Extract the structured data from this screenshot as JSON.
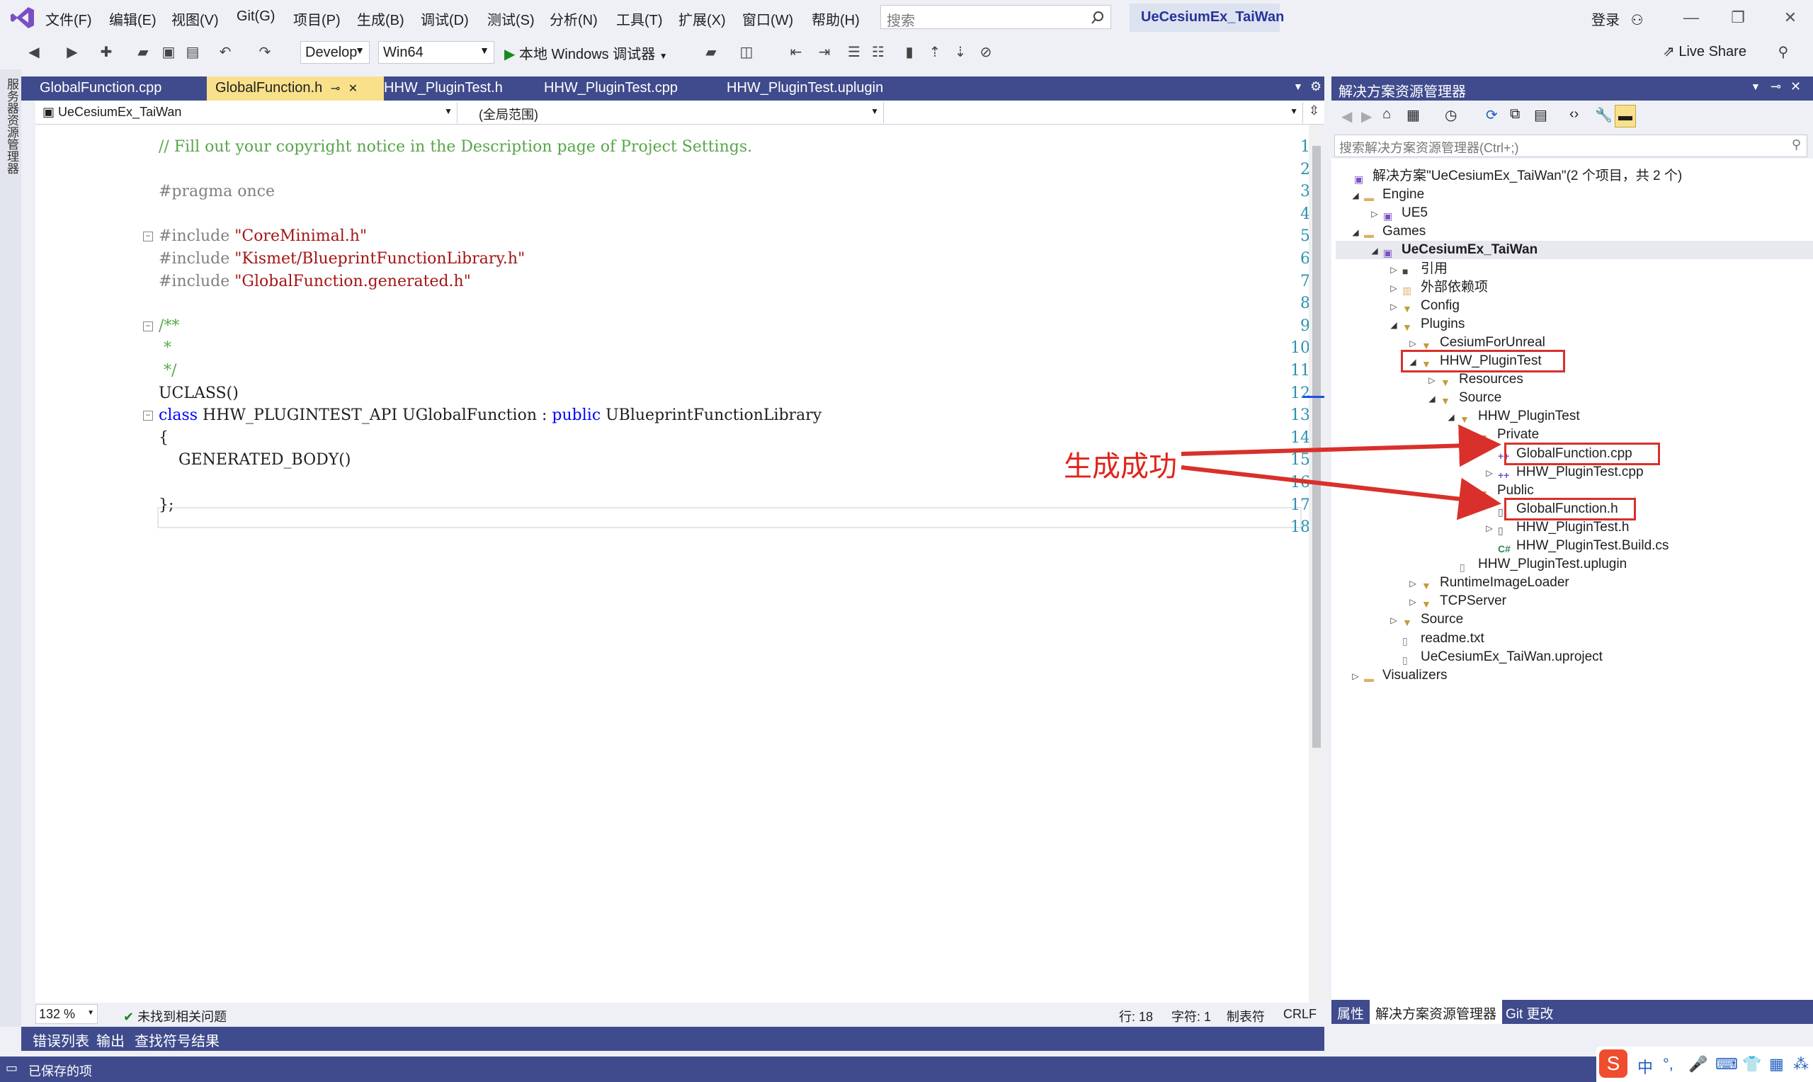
{
  "menubar": {
    "items": [
      "文件(F)",
      "编辑(E)",
      "视图(V)",
      "Git(G)",
      "项目(P)",
      "生成(B)",
      "调试(D)",
      "测试(S)",
      "分析(N)",
      "工具(T)",
      "扩展(X)",
      "窗口(W)",
      "帮助(H)"
    ],
    "search_placeholder": "搜索",
    "solution_title": "UeCesiumEx_TaiWan",
    "login_label": "登录"
  },
  "toolbar": {
    "config": "Develop",
    "platform": "Win64",
    "run_label": "本地 Windows 调试器",
    "live_share": "Live Share"
  },
  "tabs": [
    {
      "label": "GlobalFunction.cpp"
    },
    {
      "label": "GlobalFunction.h",
      "pin": "⊸",
      "close": "✕"
    },
    {
      "label": "HHW_PluginTest.h"
    },
    {
      "label": "HHW_PluginTest.cpp"
    },
    {
      "label": "HHW_PluginTest.uplugin"
    }
  ],
  "navbar": {
    "project": "UeCesiumEx_TaiWan",
    "scope": "(全局范围)",
    "member": ""
  },
  "code_lines": [
    {
      "n": "1",
      "parts": [
        [
          "cm",
          "// Fill out your copyright notice in the Description page of Project Settings."
        ]
      ]
    },
    {
      "n": "2",
      "parts": []
    },
    {
      "n": "3",
      "parts": [
        [
          "pp",
          "#pragma once"
        ]
      ]
    },
    {
      "n": "4",
      "parts": []
    },
    {
      "n": "5",
      "parts": [
        [
          "pp",
          "#include "
        ],
        [
          "str",
          "\"CoreMinimal.h\""
        ]
      ]
    },
    {
      "n": "6",
      "parts": [
        [
          "pp",
          "#include "
        ],
        [
          "str",
          "\"Kismet/BlueprintFunctionLibrary.h\""
        ]
      ]
    },
    {
      "n": "7",
      "parts": [
        [
          "pp",
          "#include "
        ],
        [
          "str",
          "\"GlobalFunction.generated.h\""
        ]
      ]
    },
    {
      "n": "8",
      "parts": []
    },
    {
      "n": "9",
      "parts": [
        [
          "cm",
          "/**"
        ]
      ]
    },
    {
      "n": "10",
      "parts": [
        [
          "cm",
          " *"
        ]
      ]
    },
    {
      "n": "11",
      "parts": [
        [
          "cm",
          " */"
        ]
      ]
    },
    {
      "n": "12",
      "parts": [
        [
          "",
          "UCLASS()"
        ]
      ]
    },
    {
      "n": "13",
      "parts": [
        [
          "kw",
          "class"
        ],
        [
          "",
          " HHW_PLUGINTEST_API UGlobalFunction : "
        ],
        [
          "kw",
          "public"
        ],
        [
          "",
          " UBlueprintFunctionLibrary"
        ]
      ]
    },
    {
      "n": "14",
      "parts": [
        [
          "",
          "{"
        ]
      ]
    },
    {
      "n": "15",
      "parts": [
        [
          "",
          "    GENERATED_BODY()"
        ]
      ]
    },
    {
      "n": "16",
      "parts": []
    },
    {
      "n": "17",
      "parts": [
        [
          "",
          "};"
        ]
      ]
    },
    {
      "n": "18",
      "parts": []
    }
  ],
  "editor_status": {
    "zoom": "132 %",
    "issues": "未找到相关问题",
    "line": "行: 18",
    "char": "字符: 1",
    "tabs": "制表符",
    "eol": "CRLF"
  },
  "bottom_tabs": [
    "错误列表",
    "输出",
    "查找符号结果"
  ],
  "statusbar": {
    "text": "已保存的项"
  },
  "solution_explorer": {
    "title": "解决方案资源管理器",
    "search_placeholder": "搜索解决方案资源管理器(Ctrl+;)",
    "nodes": [
      {
        "label": "解决方案\"UeCesiumEx_TaiWan\"(2 个项目，共 2 个)",
        "level": 0,
        "tw": "",
        "icon": "solution"
      },
      {
        "label": "Engine",
        "level": 0,
        "tw": "◢",
        "icon": "folder"
      },
      {
        "label": "UE5",
        "level": 1,
        "tw": "▷",
        "icon": "project"
      },
      {
        "label": "Games",
        "level": 0,
        "tw": "◢",
        "icon": "folder"
      },
      {
        "label": "UeCesiumEx_TaiWan",
        "level": 1,
        "tw": "◢",
        "icon": "project",
        "bold": true,
        "selected": true
      },
      {
        "label": "引用",
        "level": 2,
        "tw": "▷",
        "icon": "ref"
      },
      {
        "label": "外部依赖项",
        "level": 2,
        "tw": "▷",
        "icon": "ext"
      },
      {
        "label": "Config",
        "level": 2,
        "tw": "▷",
        "icon": "filter"
      },
      {
        "label": "Plugins",
        "level": 2,
        "tw": "◢",
        "icon": "filter"
      },
      {
        "label": "CesiumForUnreal",
        "level": 3,
        "tw": "▷",
        "icon": "filter"
      },
      {
        "label": "HHW_PluginTest",
        "level": 3,
        "tw": "◢",
        "icon": "filter"
      },
      {
        "label": "Resources",
        "level": 4,
        "tw": "▷",
        "icon": "filter"
      },
      {
        "label": "Source",
        "level": 4,
        "tw": "◢",
        "icon": "filter"
      },
      {
        "label": "HHW_PluginTest",
        "level": 5,
        "tw": "◢",
        "icon": "filter"
      },
      {
        "label": "Private",
        "level": 6,
        "tw": "◢",
        "icon": "filter"
      },
      {
        "label": "GlobalFunction.cpp",
        "level": 7,
        "tw": "",
        "icon": "cpp"
      },
      {
        "label": "HHW_PluginTest.cpp",
        "level": 7,
        "tw": "▷",
        "icon": "cpp"
      },
      {
        "label": "Public",
        "level": 6,
        "tw": "◢",
        "icon": "filter"
      },
      {
        "label": "GlobalFunction.h",
        "level": 7,
        "tw": "",
        "icon": "h"
      },
      {
        "label": "HHW_PluginTest.h",
        "level": 7,
        "tw": "▷",
        "icon": "h"
      },
      {
        "label": "HHW_PluginTest.Build.cs",
        "level": 7,
        "tw": "",
        "icon": "cs"
      },
      {
        "label": "HHW_PluginTest.uplugin",
        "level": 5,
        "tw": "",
        "icon": "file"
      },
      {
        "label": "RuntimeImageLoader",
        "level": 3,
        "tw": "▷",
        "icon": "filter"
      },
      {
        "label": "TCPServer",
        "level": 3,
        "tw": "▷",
        "icon": "filter"
      },
      {
        "label": "Source",
        "level": 2,
        "tw": "▷",
        "icon": "filter"
      },
      {
        "label": "readme.txt",
        "level": 2,
        "tw": "",
        "icon": "file"
      },
      {
        "label": "UeCesiumEx_TaiWan.uproject",
        "level": 2,
        "tw": "",
        "icon": "file"
      },
      {
        "label": "Visualizers",
        "level": 0,
        "tw": "▷",
        "icon": "folder"
      }
    ],
    "bottom_tabs": [
      "属性",
      "解决方案资源管理器",
      "Git 更改"
    ]
  },
  "left_strip": "服务器资源管理器",
  "annotation": {
    "text": "生成成功",
    "color": "#e0241b"
  }
}
